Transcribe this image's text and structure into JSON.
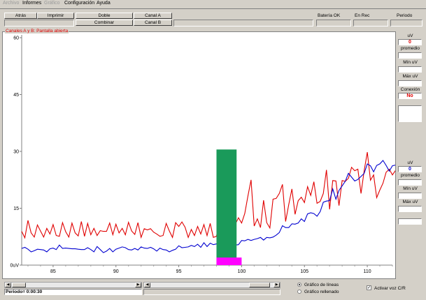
{
  "menu": [
    {
      "label": "Archivo",
      "disabled": true
    },
    {
      "label": "Informes",
      "disabled": false
    },
    {
      "label": "Gráfico",
      "disabled": true
    },
    {
      "label": "Configuración",
      "disabled": false
    },
    {
      "label": "Ayuda",
      "disabled": false
    }
  ],
  "toolbar": {
    "back": "Atrás",
    "print": "Imprimir",
    "double": "Doble",
    "combine": "Combinar",
    "channel_a": "Canal A",
    "channel_b": "Canal B",
    "battery": "Batería OK",
    "recording": "En Rec",
    "period_label": "Periodo"
  },
  "chart_title": "Canales A y B: Pantalla abierta",
  "side_top": {
    "unit": "uV",
    "value": "0",
    "average": "promedio",
    "min": "Mín uV",
    "max": "Máx uV",
    "connection_label": "Conexión",
    "connection_value": "No"
  },
  "side_bottom": {
    "unit": "uV",
    "value": "0",
    "average": "promedio",
    "min": "Mín uV",
    "max": "Máx uV"
  },
  "status": {
    "period": "Periodo= 0:00:30"
  },
  "options": {
    "line_chart": "Gráfico de líneas",
    "filled_chart": "Gráfico rellenado",
    "line_selected": true,
    "voice": "Activar voz C/R",
    "voice_checked": true
  },
  "colors": {
    "channel_a": "#e00000",
    "channel_b": "#0000d0",
    "bar": "#1a9a5a",
    "marker": "#ff00ff",
    "top_value": "#e00000",
    "bottom_value": "#0000d0"
  },
  "chart_data": {
    "type": "line",
    "title": "Canales A y B: Pantalla abierta",
    "xlim": [
      82.5,
      112
    ],
    "ylim": [
      0,
      60
    ],
    "x_ticks": [
      85,
      90,
      95,
      100,
      105,
      110
    ],
    "y_ticks": [
      "60",
      "45",
      "30",
      "15",
      "0uV"
    ],
    "y_tick_values": [
      60,
      45,
      30,
      15,
      0
    ],
    "x_start": 82.5,
    "x_step": 0.25,
    "series": [
      {
        "name": "A",
        "color": "#e00000",
        "values": [
          8.9,
          7.2,
          11.8,
          8.5,
          7.4,
          10.6,
          9.0,
          7.4,
          9.7,
          8.2,
          10.7,
          7.8,
          7.6,
          11.2,
          8.8,
          7.4,
          11.1,
          8.5,
          7.7,
          11.5,
          7.6,
          11.0,
          8.0,
          9.7,
          7.8,
          9.1,
          8.9,
          8.9,
          11.1,
          8.0,
          10.8,
          8.5,
          9.7,
          8.0,
          11.3,
          9.0,
          8.1,
          11.2,
          7.3,
          9.6,
          9.3,
          9.6,
          8.7,
          8.2,
          7.6,
          7.8,
          11.0,
          9.0,
          7.3,
          11.2,
          10.2,
          11.4,
          10.0,
          7.3,
          9.4,
          7.8,
          10.2,
          8.2,
          10.7,
          7.8,
          11.0,
          7.3,
          7.6,
          12.6,
          9.2,
          13.7,
          8.3,
          8.9,
          10.8,
          12.5,
          11.1,
          13.6,
          18.2,
          22.5,
          10.3,
          12.2,
          9.9,
          17.1,
          11.2,
          9.8,
          17.4,
          17.6,
          18.9,
          21.3,
          11.5,
          16.0,
          20.1,
          13.4,
          17.0,
          17.9,
          16.5,
          20.7,
          18.4,
          22.0,
          16.3,
          16.8,
          18.9,
          25.1,
          14.7,
          22.3,
          22.2,
          15.7,
          22.3,
          22.1,
          22.9,
          25.8,
          24.9,
          25.3,
          18.9,
          24.9,
          29.8,
          22.4,
          23.8,
          17.8,
          19.8,
          21.6,
          24.5,
          25.3,
          23.8,
          25.0,
          21.8,
          25.1,
          20.2,
          14.7,
          21.3,
          27.0,
          16.4,
          20.4,
          14.4,
          21.8,
          13.6,
          20.0,
          14.7,
          13.5,
          12.5,
          14.1,
          9.5,
          15.1,
          9.5,
          9.7,
          11.0,
          12.2,
          9.7,
          7.7,
          7.7,
          12.6,
          10.3,
          7.8,
          8.0,
          9.5,
          10.6,
          11.0,
          10.9,
          7.4,
          11.1,
          8.0,
          7.4,
          11.4,
          8.9,
          9.6,
          9.5,
          7.8,
          9.2,
          8.4,
          9.9,
          8.8,
          7.8,
          9.1,
          8.8,
          9.7,
          8.9,
          7.8,
          7.7,
          9.4,
          7.4,
          11.5,
          7.3,
          10.4,
          11.5,
          9.8,
          9.6,
          9.4,
          11.1,
          8.1,
          10.7,
          11.1,
          7.5,
          8.8,
          9.1,
          7.9,
          9.2,
          10.9,
          9.2,
          11.8,
          8.7,
          9.3,
          9.0,
          8.7,
          7.7,
          10.4,
          8.9,
          8.2,
          10.2,
          9.8,
          11.3,
          10.1,
          10.0,
          8.4,
          10.6,
          11.0,
          8.6,
          9.3,
          10.0,
          11.1,
          8.2,
          9.7,
          10.0,
          9.1
        ]
      },
      {
        "name": "B",
        "color": "#0000d0",
        "values": [
          4.4,
          4.7,
          4.2,
          3.5,
          3.8,
          4.2,
          4.1,
          4.0,
          3.5,
          4.3,
          4.5,
          4.1,
          5.3,
          4.4,
          4.5,
          4.4,
          4.3,
          4.3,
          4.2,
          4.1,
          4.1,
          4.6,
          4.1,
          3.5,
          4.9,
          4.1,
          3.3,
          3.7,
          4.4,
          3.5,
          4.2,
          4.5,
          4.8,
          4.6,
          4.1,
          4.0,
          4.4,
          4.0,
          4.8,
          4.5,
          4.4,
          4.7,
          4.3,
          3.7,
          4.5,
          4.1,
          4.0,
          3.5,
          3.9,
          4.2,
          5.1,
          4.6,
          4.7,
          4.8,
          5.2,
          4.9,
          5.5,
          4.7,
          5.9,
          4.9,
          5.8,
          5.4,
          5.6,
          5.7,
          5.4,
          5.2,
          6.0,
          4.9,
          5.3,
          5.4,
          6.5,
          6.4,
          6.8,
          6.5,
          6.8,
          7.0,
          7.3,
          6.6,
          7.3,
          7.2,
          7.4,
          7.9,
          8.6,
          10.4,
          9.9,
          9.9,
          10.9,
          10.8,
          11.1,
          12.2,
          11.5,
          13.5,
          13.8,
          13.6,
          12.9,
          14.1,
          16.6,
          16.9,
          17.0,
          20.1,
          17.4,
          19.7,
          20.9,
          22.1,
          24.2,
          23.2,
          22.2,
          22.6,
          23.4,
          24.2,
          26.7,
          26.2,
          24.6,
          26.3,
          26.7,
          27.6,
          26.3,
          24.8,
          26.2,
          26.4,
          25.3,
          25.1,
          24.0,
          22.1,
          21.9,
          21.2,
          20.4,
          19.8,
          18.2,
          18.7,
          15.9,
          16.8,
          14.6,
          14.9,
          12.7,
          13.3,
          11.3,
          11.6,
          10.0,
          10.8,
          8.5,
          10.5,
          9.1,
          8.4,
          7.9,
          8.3,
          8.2,
          6.7,
          7.8,
          6.7,
          6.9,
          6.1,
          6.6,
          5.8,
          6.6,
          6.0,
          6.1,
          5.7,
          5.9,
          5.6,
          5.3,
          6.7,
          5.5,
          5.1,
          6.3,
          6.5,
          5.9,
          6.2,
          4.7,
          6.3,
          5.7,
          6.0,
          5.9,
          5.5,
          5.8,
          6.3,
          5.9,
          5.4,
          6.2,
          5.5,
          5.6,
          6.2,
          5.4,
          6.7,
          5.4,
          6.3,
          6.0,
          5.7,
          6.2,
          6.4,
          5.5,
          5.5,
          5.8,
          5.7,
          5.8,
          5.6,
          6.5,
          6.5,
          5.6,
          5.3,
          5.1,
          5.7,
          6.1,
          4.9,
          6.2,
          6.8,
          5.3,
          6.6,
          5.4,
          6.7,
          6.6,
          6.2,
          6.2,
          5.2,
          5.8,
          4.6,
          5.1,
          5.2,
          5.6,
          5.7,
          5.2,
          5.0,
          5.6,
          5.6
        ]
      }
    ],
    "bar": {
      "x_from": 98.0,
      "x_to": 99.6,
      "y": 30.5
    },
    "marker": {
      "x_from": 98.0,
      "x_to": 100.0,
      "y_from": 0,
      "y_to": 2
    },
    "grid": false
  }
}
